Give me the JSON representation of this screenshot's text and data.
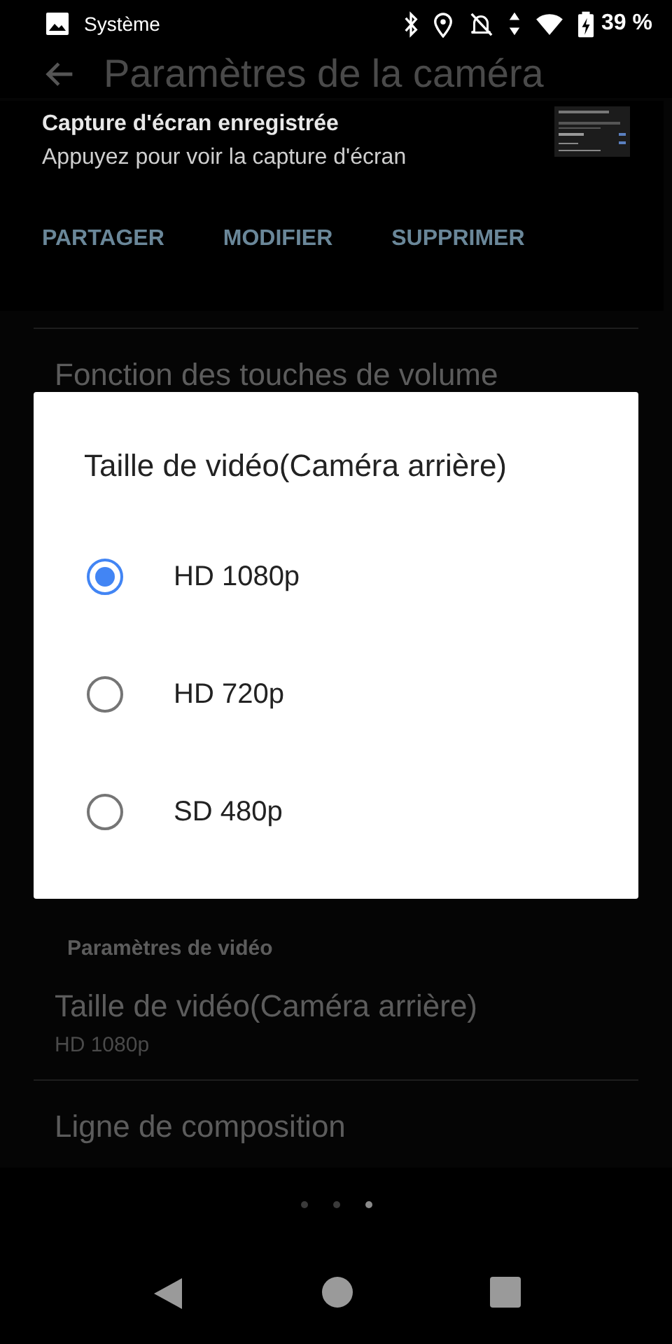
{
  "status_bar": {
    "app": "Système",
    "battery": "39 %"
  },
  "app_bar": {
    "title": "Paramètres de la caméra"
  },
  "notification": {
    "title": "Capture d'écran enregistrée",
    "text": "Appuyez pour voir la capture d'écran",
    "actions": [
      "PARTAGER",
      "MODIFIER",
      "SUPPRIMER"
    ]
  },
  "settings": {
    "items_above": [
      {
        "title": "Fonction des touches de volume"
      }
    ],
    "section": "Paramètres de vidéo",
    "items": [
      {
        "title": "Taille de vidéo(Caméra arrière)",
        "summary": "HD 1080p"
      },
      {
        "title": "Ligne de composition"
      }
    ]
  },
  "page_dots": [
    {
      "selected": false
    },
    {
      "selected": false
    },
    {
      "selected": true
    }
  ],
  "dialog": {
    "title": "Taille de vidéo(Caméra arrière)",
    "options": [
      {
        "label": "HD 1080p",
        "selected": true
      },
      {
        "label": "HD 720p",
        "selected": false
      },
      {
        "label": "SD 480p",
        "selected": false
      }
    ]
  }
}
